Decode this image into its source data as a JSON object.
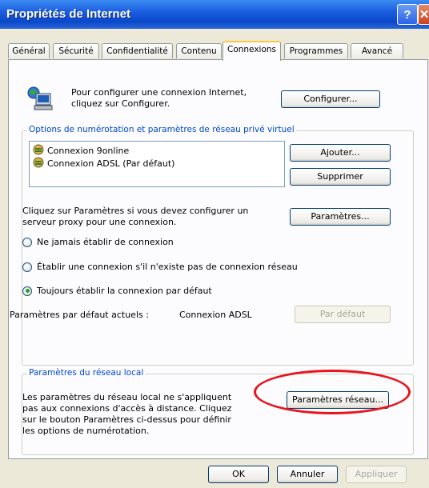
{
  "window": {
    "title": "Propriétés de Internet"
  },
  "tabs": [
    {
      "label": "Général"
    },
    {
      "label": "Sécurité"
    },
    {
      "label": "Confidentialité"
    },
    {
      "label": "Contenu"
    },
    {
      "label": "Connexions"
    },
    {
      "label": "Programmes"
    },
    {
      "label": "Avancé"
    }
  ],
  "setup": {
    "text_line1": "Pour configurer une connexion Internet,",
    "text_line2": "cliquez sur Configurer.",
    "configure_label": "Configurer..."
  },
  "dialup": {
    "legend": "Options de numérotation et paramètres de réseau privé virtuel",
    "connections": [
      {
        "label": "Connexion 9online"
      },
      {
        "label": "Connexion ADSL (Par défaut)"
      }
    ],
    "add_label": "Ajouter...",
    "remove_label": "Supprimer",
    "proxy_text_line1": "Cliquez sur Paramètres si vous devez configurer un",
    "proxy_text_line2": "serveur proxy pour une connexion.",
    "settings_label": "Paramètres...",
    "radios": [
      {
        "label": "Ne jamais établir de connexion",
        "checked": false
      },
      {
        "label": "Établir une connexion s'il n'existe pas de connexion réseau",
        "checked": false
      },
      {
        "label": "Toujours établir la connexion par défaut",
        "checked": true
      }
    ],
    "current_default_label": "Paramètres par défaut actuels :",
    "current_default_value": "Connexion ADSL",
    "set_default_label": "Par défaut"
  },
  "lan": {
    "legend": "Paramètres du réseau local",
    "text_line1": "Les paramètres du réseau local ne s'appliquent",
    "text_line2": "pas aux connexions d'accès à distance. Cliquez",
    "text_line3": "sur le bouton Paramètres ci-dessus pour définir",
    "text_line4": "les options de numérotation.",
    "lan_settings_label": "Paramètres réseau..."
  },
  "footer": {
    "ok_label": "OK",
    "cancel_label": "Annuler",
    "apply_label": "Appliquer"
  },
  "colors": {
    "title_bar": "#0a48c9",
    "group_legend": "#0046d5",
    "highlight_ring": "#e8151e",
    "selected_radio": "#21a121"
  }
}
